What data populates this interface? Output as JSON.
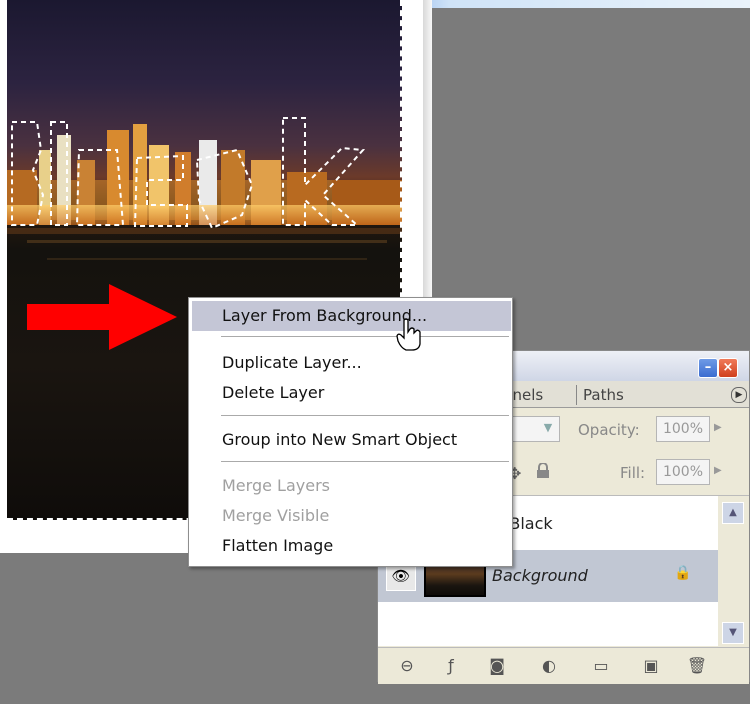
{
  "context_menu": {
    "items": [
      {
        "label": "Layer From Background...",
        "state": "highlighted"
      },
      {
        "label": "Duplicate Layer...",
        "state": "enabled"
      },
      {
        "label": "Delete Layer",
        "state": "enabled"
      },
      {
        "label": "Group into New Smart Object",
        "state": "enabled"
      },
      {
        "label": "Merge Layers",
        "state": "disabled"
      },
      {
        "label": "Merge Visible",
        "state": "disabled"
      },
      {
        "label": "Flatten Image",
        "state": "enabled"
      }
    ]
  },
  "layers_panel": {
    "tabs": [
      "nnels",
      "Paths"
    ],
    "opacity_label": "Opacity:",
    "opacity_value": "100%",
    "fill_label": "Fill:",
    "fill_value": "100%",
    "layers": [
      {
        "name": "al Black",
        "visible": false
      },
      {
        "name": "Background",
        "visible": true,
        "locked": true,
        "selected": true
      }
    ],
    "footer_icons": [
      "link-layers-icon",
      "layer-style-icon",
      "mask-icon",
      "adjustment-layer-icon",
      "folder-icon",
      "new-layer-icon",
      "trash-icon"
    ]
  },
  "colors": {
    "arrow": "#ff0000",
    "menu_highlight": "#c4c6d6",
    "selected_layer": "#c1c7d3"
  }
}
